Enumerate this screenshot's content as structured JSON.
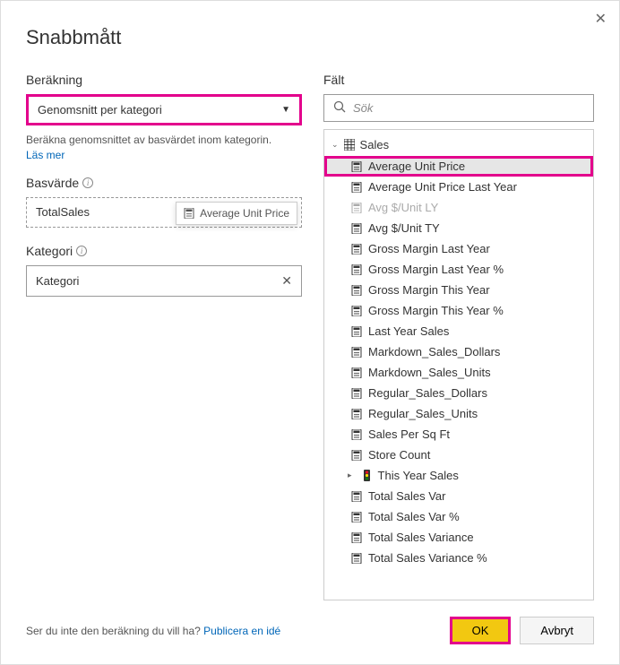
{
  "dialog": {
    "title": "Snabbmått",
    "close_label": "✕"
  },
  "calculation": {
    "label": "Beräkning",
    "selected": "Genomsnitt per kategori",
    "helper": "Beräkna genomsnittet av basvärdet inom kategorin.",
    "learn_more": "Läs mer"
  },
  "base_value": {
    "label": "Basvärde",
    "value": "TotalSales",
    "drag_chip": "Average Unit Price"
  },
  "category": {
    "label": "Kategori",
    "value": "Kategori"
  },
  "fields": {
    "label": "Fält",
    "search_placeholder": "Sök",
    "group": "Sales",
    "items": [
      {
        "label": "Average Unit Price",
        "selected": true
      },
      {
        "label": "Average Unit Price Last Year"
      },
      {
        "label": "Avg $/Unit LY",
        "dim": true
      },
      {
        "label": "Avg $/Unit TY"
      },
      {
        "label": "Gross Margin Last Year"
      },
      {
        "label": "Gross Margin Last Year %"
      },
      {
        "label": "Gross Margin This Year"
      },
      {
        "label": "Gross Margin This Year %"
      },
      {
        "label": "Last Year Sales"
      },
      {
        "label": "Markdown_Sales_Dollars"
      },
      {
        "label": "Markdown_Sales_Units"
      },
      {
        "label": "Regular_Sales_Dollars"
      },
      {
        "label": "Regular_Sales_Units"
      },
      {
        "label": "Sales Per Sq Ft"
      },
      {
        "label": "Store Count"
      },
      {
        "label": "This Year Sales",
        "kpi": true,
        "expandable": true
      },
      {
        "label": "Total Sales Var"
      },
      {
        "label": "Total Sales Var %"
      },
      {
        "label": "Total Sales Variance"
      },
      {
        "label": "Total Sales Variance %"
      }
    ]
  },
  "footer": {
    "prompt": "Ser du inte den beräkning du vill ha?",
    "link": "Publicera en idé",
    "ok": "OK",
    "cancel": "Avbryt"
  }
}
